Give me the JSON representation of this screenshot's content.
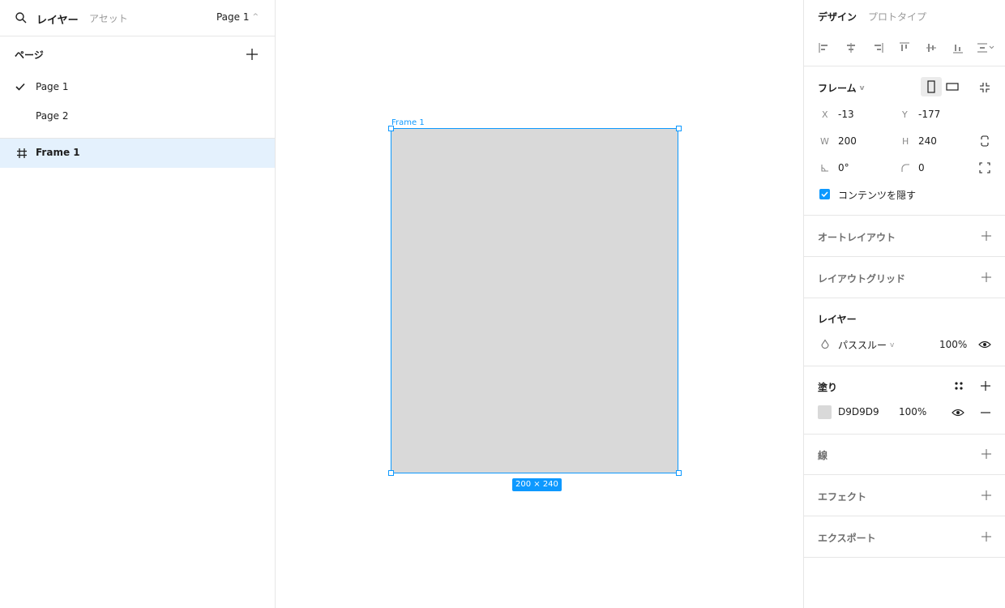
{
  "left_panel": {
    "tab_layers": "レイヤー",
    "tab_assets": "アセット",
    "current_page": "Page 1",
    "pages_title": "ページ",
    "pages": [
      {
        "label": "Page 1",
        "selected": true
      },
      {
        "label": "Page 2",
        "selected": false
      }
    ],
    "layers": [
      {
        "label": "Frame 1",
        "icon": "frame-icon"
      }
    ]
  },
  "canvas": {
    "frame_label": "Frame 1",
    "size_badge": "200 × 240",
    "frame_fill": "#D9D9D9",
    "selection_color": "#0D99FF"
  },
  "right_panel": {
    "tab_design": "デザイン",
    "tab_prototype": "プロトタイプ",
    "frame": {
      "title": "フレーム",
      "x_label": "X",
      "x": "-13",
      "y_label": "Y",
      "y": "-177",
      "w_label": "W",
      "w": "200",
      "h_label": "H",
      "h": "240",
      "rotation": "0°",
      "radius": "0",
      "clip_label": "コンテンツを隠す"
    },
    "auto_layout": "オートレイアウト",
    "layout_grid": "レイアウトグリッド",
    "layer": {
      "title": "レイヤー",
      "blend": "パススルー",
      "opacity": "100%"
    },
    "fill": {
      "title": "塗り",
      "hex": "D9D9D9",
      "opacity": "100%",
      "swatch": "#D9D9D9"
    },
    "stroke": "線",
    "effects": "エフェクト",
    "export": "エクスポート"
  }
}
